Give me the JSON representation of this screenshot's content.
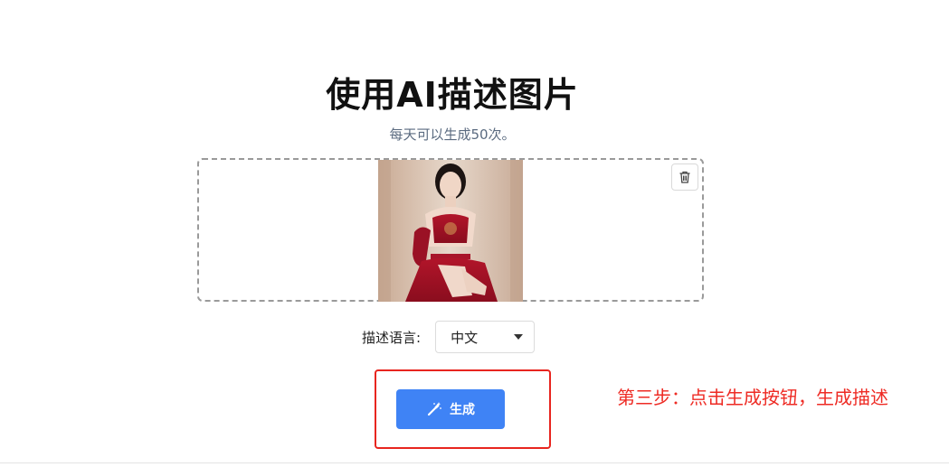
{
  "header": {
    "title": "使用AI描述图片",
    "subtitle": "每天可以生成50次。"
  },
  "upload": {
    "image_alt": "uploaded photo preview",
    "delete_icon": "trash-icon"
  },
  "language": {
    "label": "描述语言:",
    "selected": "中文"
  },
  "generate": {
    "label": "生成",
    "icon": "magic-wand-icon",
    "color": "#3f83f5"
  },
  "annotation": {
    "text": "第三步：点击生成按钮，生成描述",
    "color": "#ee2b24"
  }
}
